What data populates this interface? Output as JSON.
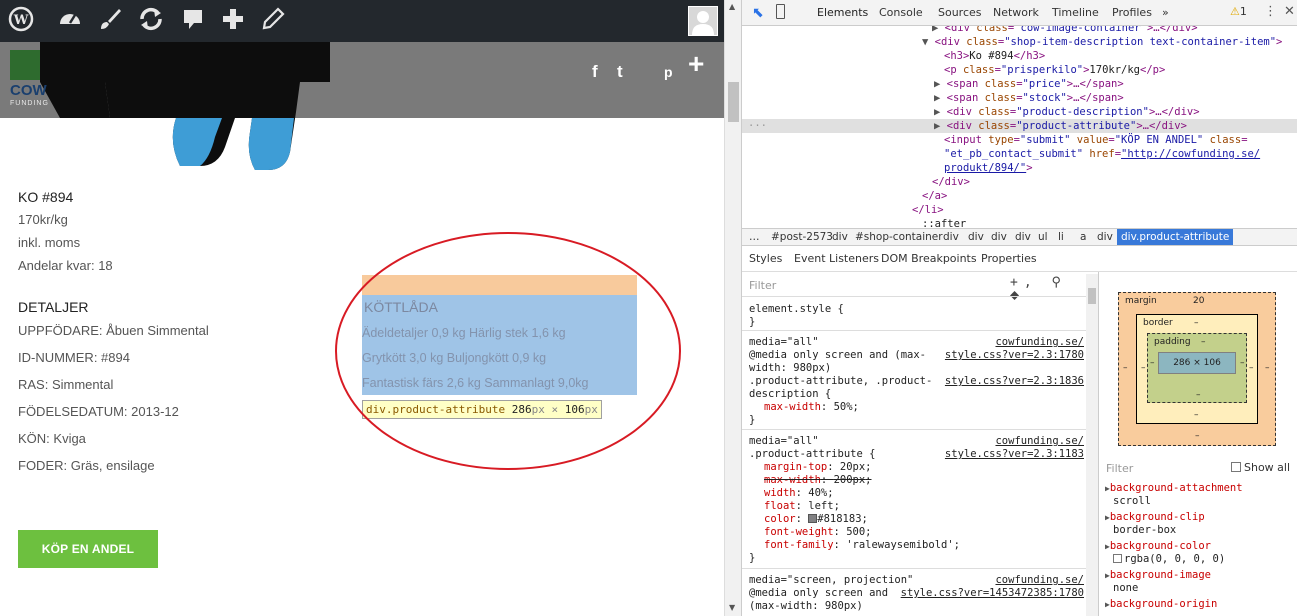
{
  "wp_toolbar": {
    "icons": [
      "wordpress-icon",
      "dashboard-icon",
      "customize-brush-icon",
      "updates-icon",
      "comments-icon",
      "new-plus-icon",
      "edit-pencil-icon"
    ],
    "avatar": "user-avatar"
  },
  "brand": {
    "logo_text": "COW",
    "logo_sub": "FUNDING"
  },
  "social": [
    "f",
    "t",
    "p",
    "+"
  ],
  "product": {
    "title": "KO #894",
    "price": "170kr/kg",
    "tax": "inkl. moms",
    "stock": "Andelar kvar: 18",
    "details_heading": "DETALJER",
    "details": [
      "UPPFÖDARE: Åbuen Simmental",
      "ID-NUMMER: #894",
      "RAS: Simmental",
      "FÖDELSEDATUM: 2013-12",
      "KÖN: Kviga",
      "FODER: Gräs, ensilage"
    ],
    "buy_label": "KÖP EN ANDEL"
  },
  "attribute": {
    "heading": "KÖTTLÅDA",
    "rows": [
      "Ädeldetaljer 0,9 kg Härlig stek 1,6 kg",
      "Grytkött 3,0 kg Buljongkött 0,9 kg",
      "Fantastisk färs 2,6 kg Sammanlagt 9,0kg"
    ]
  },
  "tooltip": {
    "selector": "div.product-attribute",
    "size": "286",
    "unit1": "px",
    "x": " × ",
    "size2": "106",
    "unit2": "px"
  },
  "devtools": {
    "tabs": [
      "Elements",
      "Console",
      "Sources",
      "Network",
      "Timeline",
      "Profiles",
      "»"
    ],
    "warn_count": "1",
    "dom_lines": [
      {
        "indent": 190,
        "parts": [
          [
            "ar",
            "▶ "
          ],
          [
            "tg",
            "<div "
          ],
          [
            "at",
            "class"
          ],
          [
            "tg",
            "="
          ],
          [
            "av",
            "\"cow-image-container\""
          ],
          [
            "tg",
            ">…</div>"
          ]
        ]
      },
      {
        "indent": 180,
        "parts": [
          [
            "ar",
            "▼ "
          ],
          [
            "tg",
            "<div "
          ],
          [
            "at",
            "class"
          ],
          [
            "tg",
            "="
          ],
          [
            "av",
            "\"shop-item-description text-container-item\""
          ],
          [
            "tg",
            ">"
          ]
        ]
      },
      {
        "indent": 202,
        "parts": [
          [
            "tg",
            "<h3>"
          ],
          [
            "tx",
            "Ko #894"
          ],
          [
            "tg",
            "</h3>"
          ]
        ]
      },
      {
        "indent": 202,
        "parts": [
          [
            "tg",
            "<p "
          ],
          [
            "at",
            "class"
          ],
          [
            "tg",
            "="
          ],
          [
            "av",
            "\"prisperkilo\""
          ],
          [
            "tg",
            ">"
          ],
          [
            "tx",
            "170kr/kg"
          ],
          [
            "tg",
            "</p>"
          ]
        ]
      },
      {
        "indent": 192,
        "parts": [
          [
            "ar",
            "▶ "
          ],
          [
            "tg",
            "<span "
          ],
          [
            "at",
            "class"
          ],
          [
            "tg",
            "="
          ],
          [
            "av",
            "\"price\""
          ],
          [
            "tg",
            ">…</span>"
          ]
        ]
      },
      {
        "indent": 192,
        "parts": [
          [
            "ar",
            "▶ "
          ],
          [
            "tg",
            "<span "
          ],
          [
            "at",
            "class"
          ],
          [
            "tg",
            "="
          ],
          [
            "av",
            "\"stock\""
          ],
          [
            "tg",
            ">…</span>"
          ]
        ]
      },
      {
        "indent": 192,
        "parts": [
          [
            "ar",
            "▶ "
          ],
          [
            "tg",
            "<div "
          ],
          [
            "at",
            "class"
          ],
          [
            "tg",
            "="
          ],
          [
            "av",
            "\"product-description\""
          ],
          [
            "tg",
            ">…</div>"
          ]
        ]
      },
      {
        "indent": 192,
        "parts": [
          [
            "ar",
            "▶ "
          ],
          [
            "tg",
            "<div "
          ],
          [
            "at",
            "class"
          ],
          [
            "tg",
            "="
          ],
          [
            "av",
            "\"product-attribute\""
          ],
          [
            "tg",
            ">…</div>"
          ]
        ],
        "selected": true
      },
      {
        "indent": 202,
        "parts": [
          [
            "tg",
            "<input "
          ],
          [
            "at",
            "type"
          ],
          [
            "tg",
            "="
          ],
          [
            "av",
            "\"submit\""
          ],
          [
            "tg",
            " "
          ],
          [
            "at",
            "value"
          ],
          [
            "tg",
            "="
          ],
          [
            "av",
            "\"KÖP EN ANDEL\""
          ],
          [
            "tg",
            " "
          ],
          [
            "at",
            "class"
          ],
          [
            "tg",
            "="
          ]
        ]
      },
      {
        "indent": 202,
        "parts": [
          [
            "av",
            "\"et_pb_contact_submit\""
          ],
          [
            "tg",
            " "
          ],
          [
            "at",
            "href"
          ],
          [
            "tg",
            "="
          ],
          [
            "lk",
            "\"http://cowfunding.se/"
          ]
        ]
      },
      {
        "indent": 202,
        "parts": [
          [
            "lk",
            "produkt/894/\""
          ],
          [
            "tg",
            ">"
          ]
        ]
      },
      {
        "indent": 190,
        "parts": [
          [
            "tg",
            "</div>"
          ]
        ]
      },
      {
        "indent": 180,
        "parts": [
          [
            "tg",
            "</a>"
          ]
        ]
      },
      {
        "indent": 170,
        "parts": [
          [
            "tg",
            "</li>"
          ]
        ]
      },
      {
        "indent": 180,
        "parts": [
          [
            "tx",
            "::after"
          ]
        ]
      }
    ],
    "crumbs": [
      "…",
      "#post-2573",
      "div",
      "#shop-container",
      "div",
      "div",
      "div",
      "div",
      "ul",
      "li",
      "a",
      "div",
      "div.product-attribute"
    ],
    "subtabs": [
      "Styles",
      "Event Listeners",
      "DOM Breakpoints",
      "Properties"
    ],
    "filter_placeholder": "Filter",
    "filter_buttons": "+, ⚲ ⬥",
    "rules": {
      "element_style": "element.style {",
      "close": "}",
      "r1": {
        "media": "media=\"all\"",
        "src": "cowfunding.se/",
        "q1": "@media only screen and (max-",
        "src2": "style.css?ver=2.3:1780",
        "q2": "width: 980px)",
        "sel": ".product-attribute, .product-",
        "src3": "style.css?ver=2.3:1836",
        "sel2": "description {",
        "props": [
          [
            "max-width",
            "50%"
          ]
        ]
      },
      "r2": {
        "media": "media=\"all\"",
        "src": "cowfunding.se/",
        "sel": ".product-attribute {",
        "src2": "style.css?ver=2.3:1183",
        "props": [
          [
            "margin-top",
            "20px",
            false
          ],
          [
            "max-width",
            "200px",
            true
          ],
          [
            "width",
            "40%",
            false
          ],
          [
            "float",
            "left",
            false
          ],
          [
            "color",
            "#818183",
            false
          ],
          [
            "font-weight",
            "500",
            false
          ],
          [
            "font-family",
            "'ralewaysemibold'",
            false
          ]
        ]
      },
      "r3": {
        "media": "media=\"screen, projection\"",
        "src": "cowfunding.se/",
        "q1": "@media only screen and",
        "src2": "style.css?ver=1453472385:1780",
        "q2": "(max-width: 980px)"
      }
    },
    "boxmodel": {
      "margin_label": "margin",
      "margin_value": "20",
      "border_label": "border",
      "padding_label": "padding",
      "dash": "–",
      "content": "286 × 106"
    },
    "computed_filter": "Filter",
    "show_all": "Show all",
    "computed": [
      [
        "background-attachment",
        "scroll"
      ],
      [
        "background-clip",
        "border-box"
      ],
      [
        "background-color",
        "rgba(0, 0, 0, 0)"
      ],
      [
        "background-image",
        "none"
      ],
      [
        "background-origin",
        ""
      ]
    ]
  }
}
